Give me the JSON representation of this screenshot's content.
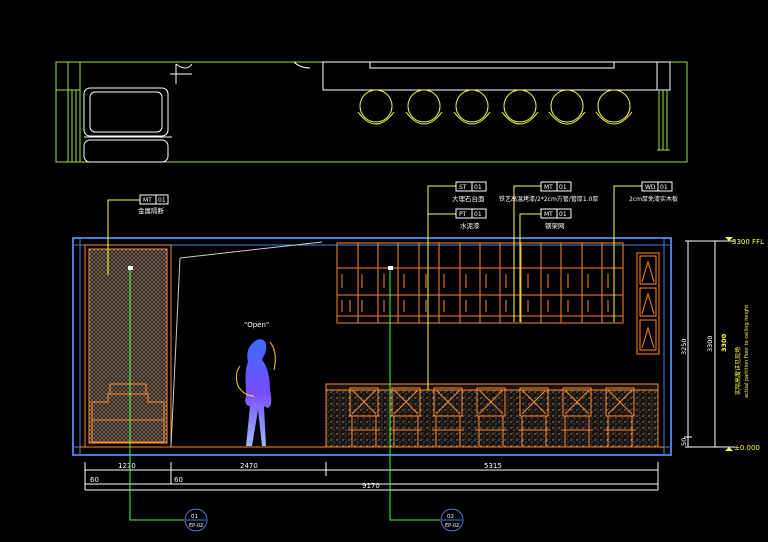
{
  "tags": {
    "mt_metal": {
      "code": "MT",
      "num": "01",
      "desc": "金属隔断"
    },
    "st_marble": {
      "code": "ST",
      "num": "01",
      "desc": "大理石台面"
    },
    "pt_paint": {
      "code": "PT",
      "num": "01",
      "desc": "水泥漆"
    },
    "mt_iron": {
      "code": "MT",
      "num": "01",
      "desc": "铁艺高温烤漆/2*2cm方管/管厚1.0厚"
    },
    "mt_steel": {
      "code": "MT",
      "num": "01",
      "desc": "钢架网"
    },
    "wd_wood": {
      "code": "WD",
      "num": "01",
      "desc": "2cm厚免漆实木板"
    }
  },
  "level_top": "3300 FFL",
  "level_bottom": "±0.000",
  "dims_vertical": {
    "d1": "3250",
    "d2": "50",
    "d3": "3300",
    "d4": "3300"
  },
  "ceiling_note": {
    "line1": "实际高度详见现场",
    "line2": "actual partition floor to ceiling height"
  },
  "dims_horizontal_top": [
    "1270",
    "2470",
    "5315"
  ],
  "dims_horizontal_small": [
    "60",
    "60"
  ],
  "dim_total": "9170",
  "figure_caption": "\"Open\"",
  "section_markers": [
    {
      "num": "01",
      "sheet": "EP-02"
    },
    {
      "num": "02",
      "sheet": "EP-02"
    }
  ]
}
